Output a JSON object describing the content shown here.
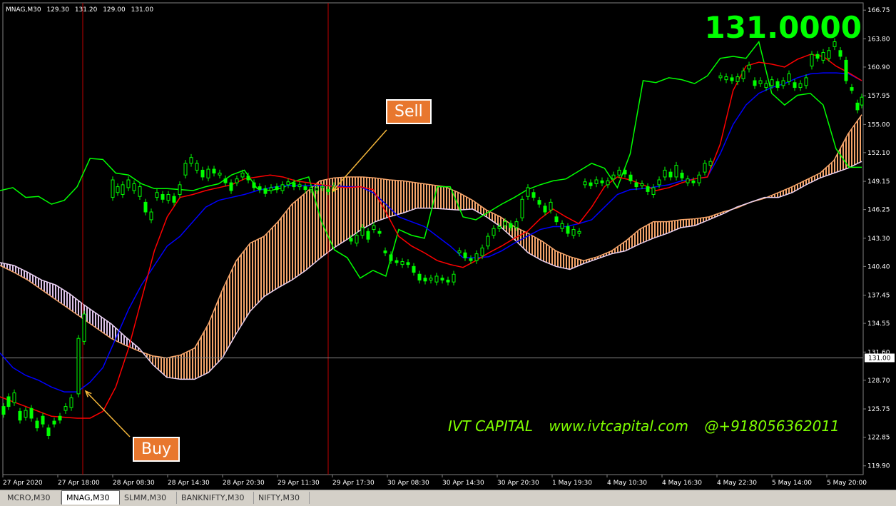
{
  "header": {
    "symbol": "MNAG,M30",
    "open": "129.30",
    "high": "131.20",
    "low": "129.00",
    "close": "131.00"
  },
  "current_price_big": "131.0000",
  "callouts": {
    "sell": "Sell",
    "buy": "Buy"
  },
  "watermark": {
    "name": "IVT CAPITAL",
    "site": "www.ivtcapital.com",
    "phone": "@+918056362011"
  },
  "tabs": [
    {
      "label": "MCRO,M30",
      "active": false
    },
    {
      "label": "MNAG,M30",
      "active": true
    },
    {
      "label": "SLMM,M30",
      "active": false
    },
    {
      "label": "BANKNIFTY,M30",
      "active": false
    },
    {
      "label": "NIFTY,M30",
      "active": false
    }
  ],
  "chart_data": {
    "type": "line",
    "ylim": [
      119.0,
      167.5
    ],
    "y_ticks": [
      "166.75",
      "163.80",
      "160.90",
      "157.95",
      "155.00",
      "152.10",
      "149.15",
      "146.25",
      "143.30",
      "140.40",
      "137.45",
      "134.55",
      "131.60",
      "128.70",
      "125.75",
      "122.85",
      "119.90"
    ],
    "x_ticks": [
      "27 Apr 2020",
      "27 Apr 18:00",
      "28 Apr 08:30",
      "28 Apr 14:30",
      "28 Apr 20:30",
      "29 Apr 11:30",
      "29 Apr 17:30",
      "30 Apr 08:30",
      "30 Apr 14:30",
      "30 Apr 20:30",
      "1 May 19:30",
      "4 May 10:30",
      "4 May 16:30",
      "4 May 22:30",
      "5 May 14:00",
      "5 May 20:00"
    ],
    "current_price": 131.0,
    "current_price_label": "131.00",
    "colors": {
      "red": "#ff0000",
      "blue": "#0000ff",
      "green": "#00ff00",
      "senkou_up": "#f4a46a",
      "senkou_down": "#dcc0e8",
      "vline": "#c00000",
      "candle": "#00ff00"
    },
    "tenkan_red": [
      127,
      126.5,
      126,
      125.5,
      125,
      124.9,
      124.8,
      124.8,
      125.5,
      128,
      132,
      137,
      142,
      145.5,
      147.5,
      147.8,
      148.2,
      148.5,
      148.8,
      149.4,
      149.6,
      149.8,
      149.6,
      149.2,
      149,
      148.8,
      148.6,
      148.5,
      148.6,
      148.3,
      146,
      143.5,
      142.5,
      141.8,
      141,
      140.6,
      140.3,
      141,
      141.8,
      142.5,
      143.3,
      144,
      145.3,
      146.3,
      145.5,
      144.8,
      146.5,
      148.6,
      149.6,
      149.3,
      148.8,
      148.2,
      148.5,
      149,
      149.4,
      149.6,
      153,
      158.5,
      161,
      161.4,
      161.2,
      160.9,
      161.7,
      162.2,
      162,
      161,
      160.3,
      159.5
    ],
    "kijun_blue": [
      131.5,
      130,
      129.2,
      128.7,
      128,
      127.5,
      127.5,
      128.5,
      130,
      133,
      136,
      138.5,
      140.5,
      142.5,
      143.5,
      145,
      146.5,
      147.2,
      147.5,
      147.8,
      148.2,
      148.5,
      148.7,
      148.7,
      148.7,
      148.7,
      148.7,
      148.6,
      148.6,
      148,
      146.8,
      145.5,
      145,
      144.5,
      143.5,
      142.5,
      141.3,
      141.3,
      141.4,
      142,
      142.8,
      143.5,
      144.2,
      144.5,
      144.5,
      144.8,
      145.2,
      146.5,
      147.8,
      148.3,
      148.4,
      148.6,
      148.8,
      149.2,
      149.4,
      149.6,
      152,
      155,
      157,
      158.2,
      158.8,
      159.2,
      159.8,
      160.2,
      160.3,
      160.3,
      160.2,
      159.5
    ],
    "chikou_green": [
      148.2,
      148.5,
      147.5,
      147.6,
      146.8,
      147.2,
      148.6,
      151.5,
      151.4,
      150,
      149.8,
      148.9,
      148.4,
      148.4,
      148.3,
      148.2,
      148.6,
      148.9,
      149.8,
      150.3,
      148.4,
      148.2,
      148.5,
      149.2,
      149.6,
      145,
      142.1,
      141.3,
      139.2,
      140,
      139.4,
      144.2,
      143.6,
      143.3,
      148.6,
      148.6,
      145.5,
      145.2,
      146,
      146.8,
      147.5,
      148.3,
      148.8,
      149.2,
      149.4,
      150.2,
      151,
      150.5,
      148.5,
      152,
      159.5,
      159.3,
      159.8,
      159.6,
      159.2,
      160,
      161.8,
      162,
      161.8,
      163.5,
      158.2,
      157,
      158,
      158.2,
      157,
      152.5,
      150.6,
      150.6
    ],
    "senkou_a": [
      140.5,
      139.8,
      139,
      138,
      137,
      136,
      135,
      134,
      133,
      132.3,
      131.7,
      131.2,
      131,
      131.3,
      132,
      134.5,
      138,
      141,
      142.8,
      143.5,
      145,
      146.8,
      148,
      149.2,
      149.5,
      149.6,
      149.6,
      149.5,
      149.3,
      149.2,
      149,
      148.8,
      148.6,
      148,
      147.2,
      146.2,
      145.5,
      144.5,
      143.8,
      143,
      142,
      141.4,
      141,
      141.4,
      142,
      143,
      144.2,
      145,
      145,
      145.2,
      145.3,
      145.5,
      146,
      146.4,
      147,
      147.4,
      148,
      148.6,
      149.3,
      150,
      151.3,
      154,
      156
    ],
    "senkou_b": [
      140.8,
      140.5,
      139.8,
      139,
      138.5,
      137.6,
      136.5,
      135.5,
      134.5,
      133.2,
      132,
      130.3,
      129,
      128.8,
      128.8,
      129.5,
      131,
      133.5,
      135.8,
      137.3,
      138.2,
      139,
      140,
      141.2,
      142.3,
      143.2,
      144.2,
      145,
      145.5,
      145.9,
      146.4,
      146.4,
      146.3,
      146.2,
      146.3,
      145.5,
      144.5,
      143.2,
      141.8,
      141,
      140.4,
      140.1,
      140.7,
      141.2,
      141.7,
      142,
      142.7,
      143.3,
      143.8,
      144.4,
      144.6,
      145.2,
      145.8,
      146.5,
      147,
      147.5,
      147.5,
      148,
      148.8,
      149.5,
      150,
      150.5,
      151.2
    ],
    "candles": [
      [
        5,
        126.0,
        125.2
      ],
      [
        12,
        127.0,
        126.0
      ],
      [
        20,
        126.4,
        127.4
      ],
      [
        28,
        125.5,
        124.6
      ],
      [
        36,
        124.9,
        125.6
      ],
      [
        44,
        125.8,
        124.8
      ],
      [
        52,
        124.5,
        123.8
      ],
      [
        60,
        125.0,
        124.2
      ],
      [
        68,
        123.8,
        123.0
      ],
      [
        76,
        124.5,
        124.2
      ],
      [
        84,
        125.0,
        124.6
      ],
      [
        92,
        125.6,
        126.0
      ],
      [
        100,
        125.9,
        126.9
      ],
      [
        110,
        127.3,
        133.0
      ],
      [
        118,
        132.7,
        135.5
      ],
      [
        158,
        147.5,
        149.3
      ],
      [
        165,
        148.0,
        148.6
      ],
      [
        172,
        147.8,
        148.8
      ],
      [
        180,
        148.5,
        149.3
      ],
      [
        188,
        148.2,
        148.9
      ],
      [
        196,
        147.6,
        148.6
      ],
      [
        204,
        147.0,
        146.0
      ],
      [
        212,
        145.2,
        146.0
      ],
      [
        220,
        147.5,
        148.0
      ],
      [
        228,
        147.8,
        147.3
      ],
      [
        236,
        147.2,
        147.8
      ],
      [
        244,
        147.6,
        147.0
      ],
      [
        252,
        147.8,
        148.8
      ],
      [
        260,
        149.8,
        151.0
      ],
      [
        268,
        151.0,
        151.6
      ],
      [
        276,
        150.3,
        151.0
      ],
      [
        284,
        150.3,
        149.6
      ],
      [
        292,
        149.5,
        150.4
      ],
      [
        300,
        150.4,
        150.0
      ],
      [
        308,
        149.8,
        150.0
      ],
      [
        316,
        149.4,
        149.0
      ],
      [
        324,
        149.0,
        148.2
      ],
      [
        332,
        149.0,
        149.4
      ],
      [
        340,
        149.6,
        150.0
      ],
      [
        348,
        149.7,
        149.3
      ],
      [
        356,
        149.0,
        148.5
      ],
      [
        364,
        148.6,
        148.3
      ],
      [
        372,
        148.4,
        147.9
      ],
      [
        380,
        148.2,
        148.5
      ],
      [
        388,
        148.6,
        148.3
      ],
      [
        396,
        148.2,
        148.8
      ],
      [
        404,
        148.8,
        149.1
      ],
      [
        412,
        149.0,
        148.6
      ],
      [
        420,
        148.6,
        148.8
      ],
      [
        428,
        148.6,
        148.3
      ],
      [
        436,
        148.3,
        148.5
      ],
      [
        444,
        148.2,
        148.5
      ],
      [
        452,
        148.5,
        148.6
      ],
      [
        460,
        148.3,
        148.1
      ],
      [
        468,
        148.4,
        148.7
      ],
      [
        492,
        143.3,
        143.0
      ],
      [
        500,
        142.8,
        143.6
      ],
      [
        508,
        143.6,
        144.4
      ],
      [
        516,
        144.0,
        143.2
      ],
      [
        524,
        144.2,
        144.6
      ],
      [
        532,
        144.0,
        143.8
      ],
      [
        540,
        142.0,
        141.8
      ],
      [
        548,
        141.6,
        141.0
      ],
      [
        556,
        141.0,
        140.8
      ],
      [
        564,
        140.6,
        140.9
      ],
      [
        572,
        140.8,
        140.6
      ],
      [
        580,
        140.4,
        139.8
      ],
      [
        588,
        139.6,
        139.0
      ],
      [
        596,
        139.2,
        138.9
      ],
      [
        604,
        139.0,
        139.2
      ],
      [
        612,
        138.8,
        139.4
      ],
      [
        620,
        139.2,
        139.0
      ],
      [
        628,
        139.0,
        138.8
      ],
      [
        636,
        138.8,
        139.6
      ],
      [
        644,
        141.8,
        142.0
      ],
      [
        652,
        141.8,
        141.3
      ],
      [
        660,
        141.2,
        141.0
      ],
      [
        668,
        141.0,
        141.7
      ],
      [
        676,
        141.5,
        142.3
      ],
      [
        684,
        142.5,
        143.5
      ],
      [
        692,
        143.6,
        144.3
      ],
      [
        700,
        144.3,
        144.5
      ],
      [
        708,
        144.6,
        145.0
      ],
      [
        716,
        144.8,
        144.4
      ],
      [
        724,
        144.4,
        145.0
      ],
      [
        732,
        145.4,
        147.3
      ],
      [
        740,
        147.6,
        148.5
      ],
      [
        748,
        148.0,
        147.5
      ],
      [
        756,
        147.2,
        146.8
      ],
      [
        764,
        146.6,
        146.0
      ],
      [
        772,
        146.2,
        147.0
      ],
      [
        780,
        145.5,
        145.0
      ],
      [
        788,
        144.3,
        144.8
      ],
      [
        796,
        144.5,
        143.8
      ],
      [
        804,
        143.6,
        144.2
      ],
      [
        812,
        143.8,
        144.0
      ],
      [
        820,
        148.8,
        149.1
      ],
      [
        828,
        149.0,
        148.7
      ],
      [
        836,
        148.9,
        149.3
      ],
      [
        844,
        149.2,
        149.0
      ],
      [
        852,
        148.8,
        149.2
      ],
      [
        860,
        149.4,
        149.8
      ],
      [
        868,
        149.8,
        150.3
      ],
      [
        876,
        150.3,
        149.9
      ],
      [
        884,
        149.8,
        149.2
      ],
      [
        892,
        149.0,
        148.6
      ],
      [
        900,
        148.7,
        148.9
      ],
      [
        908,
        148.6,
        148.1
      ],
      [
        916,
        147.8,
        148.5
      ],
      [
        924,
        148.8,
        149.3
      ],
      [
        932,
        149.6,
        150.3
      ],
      [
        940,
        150.1,
        149.6
      ],
      [
        948,
        149.6,
        150.8
      ],
      [
        956,
        150.0,
        149.5
      ],
      [
        964,
        149.0,
        149.4
      ],
      [
        972,
        149.2,
        149.0
      ],
      [
        980,
        149.0,
        149.8
      ],
      [
        988,
        150.1,
        151.0
      ],
      [
        996,
        150.8,
        151.2
      ],
      [
        1010,
        159.8,
        160.0
      ],
      [
        1018,
        159.6,
        159.9
      ],
      [
        1026,
        159.8,
        159.5
      ],
      [
        1034,
        159.4,
        159.9
      ],
      [
        1042,
        159.7,
        160.5
      ],
      [
        1050,
        160.7,
        161.1
      ],
      [
        1058,
        159.5,
        159.0
      ],
      [
        1066,
        159.2,
        159.5
      ],
      [
        1074,
        158.8,
        159.2
      ],
      [
        1082,
        159.0,
        159.6
      ],
      [
        1090,
        159.4,
        158.8
      ],
      [
        1098,
        159.0,
        159.5
      ],
      [
        1106,
        159.4,
        160.2
      ],
      [
        1114,
        159.3,
        158.8
      ],
      [
        1122,
        158.8,
        159.2
      ],
      [
        1130,
        159.0,
        159.8
      ],
      [
        1138,
        161.0,
        162.2
      ],
      [
        1146,
        162.2,
        161.8
      ],
      [
        1154,
        161.6,
        162.4
      ],
      [
        1162,
        161.8,
        162.6
      ],
      [
        1170,
        163.0,
        163.5
      ],
      [
        1178,
        162.6,
        162.0
      ],
      [
        1186,
        161.6,
        159.5
      ],
      [
        1194,
        158.8,
        158.5
      ],
      [
        1202,
        157.2,
        156.5
      ],
      [
        1208,
        157.0,
        157.8
      ]
    ]
  }
}
